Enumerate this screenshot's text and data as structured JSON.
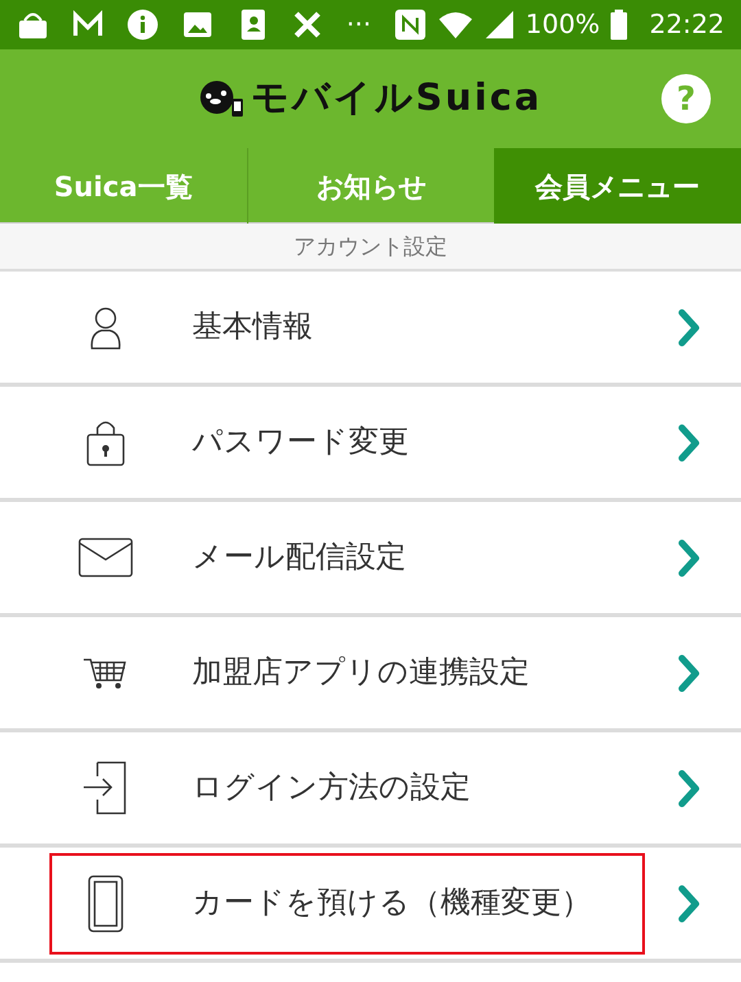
{
  "status_bar": {
    "overflow": "···",
    "battery": "100%",
    "time": "22:22"
  },
  "header": {
    "logo": "モバイルSuica",
    "help": "?"
  },
  "tabs": [
    {
      "label": "Suica一覧",
      "selected": false
    },
    {
      "label": "お知らせ",
      "selected": false
    },
    {
      "label": "会員メニュー",
      "selected": true
    }
  ],
  "section": {
    "title": "アカウント設定"
  },
  "menu_items": [
    {
      "kind": "person",
      "label": "基本情報",
      "highlighted": false
    },
    {
      "kind": "lock",
      "label": "パスワード変更",
      "highlighted": false
    },
    {
      "kind": "mail",
      "label": "メール配信設定",
      "highlighted": false
    },
    {
      "kind": "cart",
      "label": "加盟店アプリの連携設定",
      "highlighted": false
    },
    {
      "kind": "login",
      "label": "ログイン方法の設定",
      "highlighted": false
    },
    {
      "kind": "phone",
      "label": "カードを預ける（機種変更）",
      "highlighted": true
    }
  ]
}
